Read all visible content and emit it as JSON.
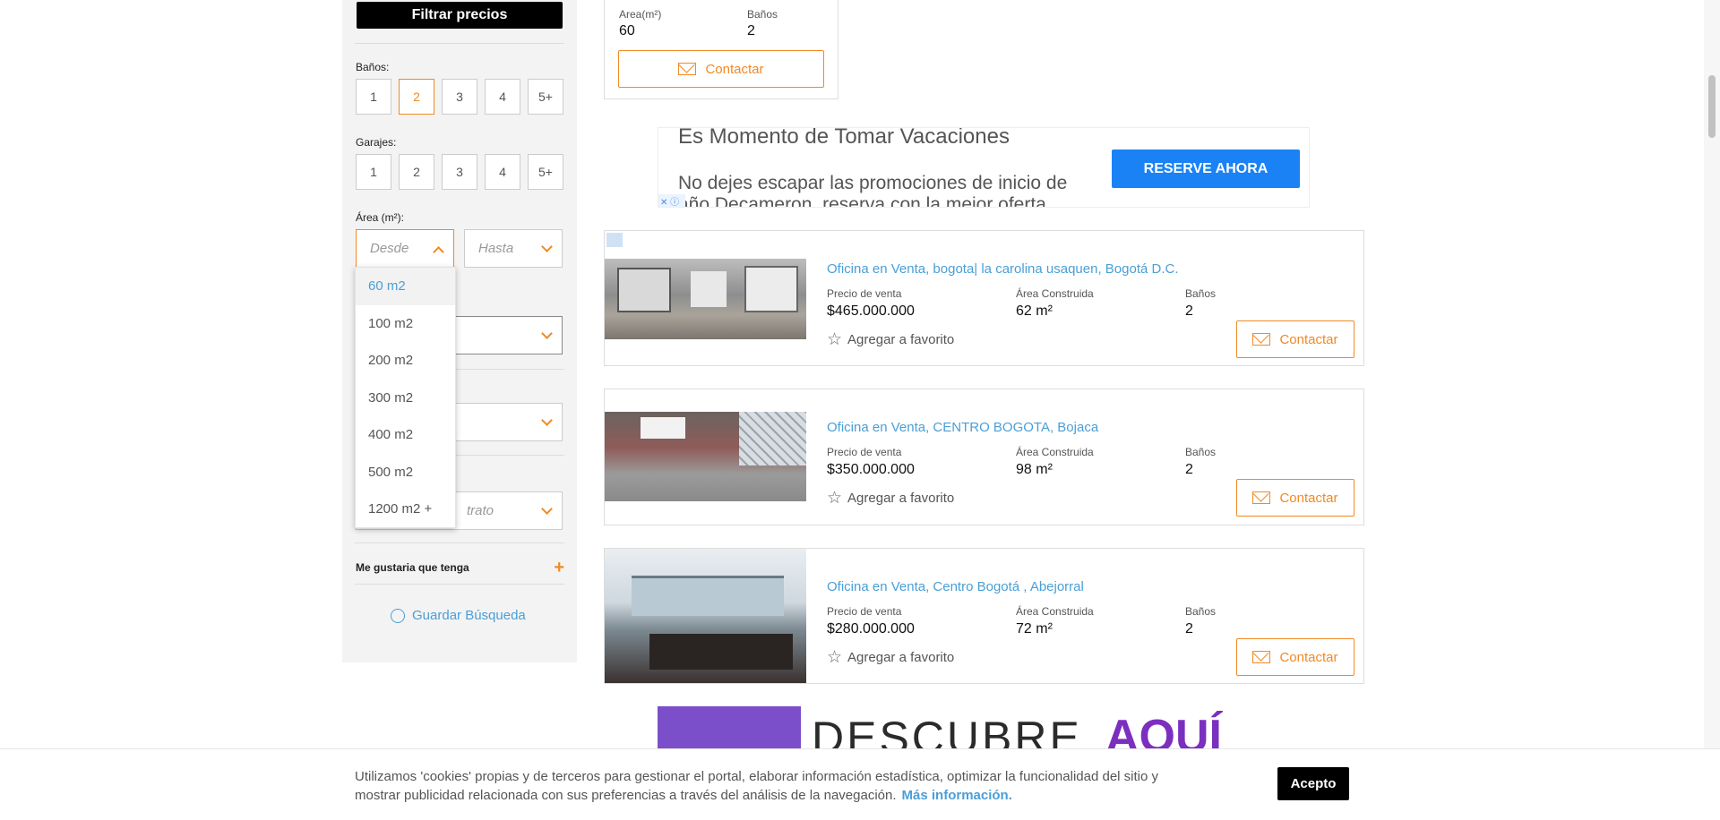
{
  "sidebar": {
    "filter_button": "Filtrar precios",
    "banos_label": "Baños:",
    "banos_options": [
      "1",
      "2",
      "3",
      "4",
      "5+"
    ],
    "banos_selected": "2",
    "garajes_label": "Garajes:",
    "garajes_options": [
      "1",
      "2",
      "3",
      "4",
      "5+"
    ],
    "area_label": "Área (m²):",
    "area_from_placeholder": "Desde",
    "area_to_placeholder": "Hasta",
    "area_options": [
      "60 m2",
      "100 m2",
      "200 m2",
      "300 m2",
      "400 m2",
      "500 m2",
      "1200 m2 +"
    ],
    "area_highlighted": "60 m2",
    "contract_partial": "trato",
    "extras_label": "Me gustaria que tenga",
    "save_search": "Guardar Búsqueda"
  },
  "top_card": {
    "area_label": "Area(m²)",
    "area_value": "60",
    "banos_label": "Baños",
    "banos_value": "2",
    "contact": "Contactar"
  },
  "ad": {
    "headline": "Es Momento de Tomar Vacaciones",
    "body": "No dejes escapar las promociones de inicio de año Decameron, reserva con la mejor oferta",
    "cta": "RESERVE AHORA"
  },
  "listings": [
    {
      "title": "Oficina en Venta, bogota| la carolina usaquen, Bogotá D.C.",
      "price_label": "Precio de venta",
      "price": "$465.000.000",
      "area_label": "Área Construida",
      "area": "62 m²",
      "banos_label": "Baños",
      "banos": "2",
      "fav": "Agregar a favorito",
      "contact": "Contactar"
    },
    {
      "title": "Oficina en Venta, CENTRO BOGOTA, Bojaca",
      "price_label": "Precio de venta",
      "price": "$350.000.000",
      "area_label": "Área Construida",
      "area": "98 m²",
      "banos_label": "Baños",
      "banos": "2",
      "fav": "Agregar a favorito",
      "contact": "Contactar"
    },
    {
      "title": "Oficina en Venta, Centro Bogotá , Abejorral",
      "price_label": "Precio de venta",
      "price": "$280.000.000",
      "area_label": "Área Construida",
      "area": "72 m²",
      "banos_label": "Baños",
      "banos": "2",
      "fav": "Agregar a favorito",
      "contact": "Contactar"
    }
  ],
  "banner2": {
    "text_a": "DESCUBRE",
    "text_b": "AQUÍ"
  },
  "cookie": {
    "text": "Utilizamos 'cookies' propias y de terceros para gestionar el portal, elaborar información estadística, optimizar la funcionalidad del sitio y mostrar publicidad relacionada con sus preferencias a través del análisis de la navegación.",
    "more": "Más información.",
    "accept": "Acepto"
  },
  "colors": {
    "accent": "#f08a24",
    "link": "#4a9fd6",
    "ad_button": "#1a82f5"
  }
}
